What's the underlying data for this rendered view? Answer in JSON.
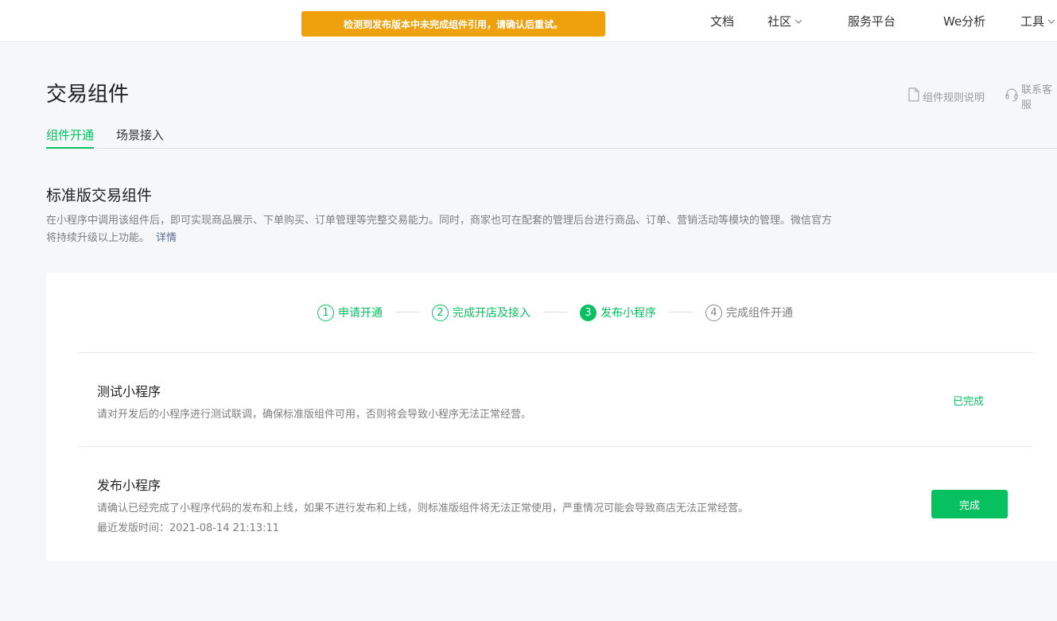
{
  "banner": {
    "warning": "检测到发布版本中未完成组件引用，请确认后重试。"
  },
  "nav": {
    "docs": "文档",
    "community": "社区",
    "service_platform": "服务平台",
    "we_analysis": "We分析",
    "tools": "工具"
  },
  "page": {
    "title": "交易组件",
    "rules_link": "组件规则说明",
    "customer_service": "联系客服"
  },
  "tabs": [
    "组件开通",
    "场景接入"
  ],
  "section": {
    "title": "标准版交易组件",
    "description_line1": "在小程序中调用该组件后，即可实现商品展示、下单购买、订单管理等完整交易能力。同时，商家也可在配套的管理后台进行商品、订单、营销活动等模块的管理。微信官方",
    "description_line2": "将持续升级以上功能。",
    "detail_link": "详情"
  },
  "steps": [
    {
      "num": "1",
      "label": "申请开通",
      "state": "done"
    },
    {
      "num": "2",
      "label": "完成开店及接入",
      "state": "done"
    },
    {
      "num": "3",
      "label": "发布小程序",
      "state": "current"
    },
    {
      "num": "4",
      "label": "完成组件开通",
      "state": "todo"
    }
  ],
  "rows": {
    "test": {
      "title": "测试小程序",
      "description": "请对开发后的小程序进行测试联调，确保标准版组件可用，否则将会导致小程序无法正常经营。",
      "status": "已完成"
    },
    "publish": {
      "title": "发布小程序",
      "description": "请确认已经完成了小程序代码的发布和上线，如果不进行发布和上线，则标准版组件将无法正常使用，严重情况可能会导致商店无法正常经营。",
      "latest_release": "最近发版时间：2021-08-14 21:13:11",
      "button": "完成"
    }
  },
  "colors": {
    "accent": "#07c160",
    "warning": "#eea10d",
    "link": "#576b95"
  }
}
